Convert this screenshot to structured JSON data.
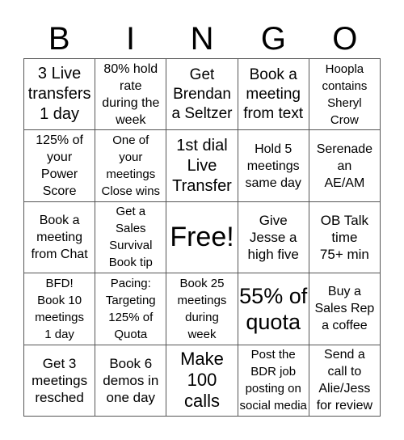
{
  "header": [
    "B",
    "I",
    "N",
    "G",
    "O"
  ],
  "cells": [
    [
      "3 Live\ntransfers\n1 day",
      "80% hold\nrate\nduring the\nweek",
      "Get\nBrendan\na Seltzer",
      "Book a\nmeeting\nfrom text",
      "Hoopla\ncontains\nSheryl\nCrow"
    ],
    [
      "125% of\nyour\nPower\nScore",
      "One of\nyour\nmeetings\nClose wins",
      "1st dial\nLive\nTransfer",
      "Hold 5\nmeetings\nsame day",
      "Serenade\nan\nAE/AM"
    ],
    [
      "Book a\nmeeting\nfrom Chat",
      "Get a\nSales\nSurvival\nBook tip",
      "Free!",
      "Give\nJesse a\nhigh five",
      "OB Talk\ntime\n75+ min"
    ],
    [
      "BFD!\nBook 10\nmeetings\n1 day",
      "Pacing:\nTargeting\n125% of\nQuota",
      "Book 25\nmeetings\nduring\nweek",
      "55% of\nquota",
      "Buy a\nSales Rep\na coffee"
    ],
    [
      "Get 3\nmeetings\nresched",
      "Book 6\ndemos in\none day",
      "Make\n100\ncalls",
      "Post the\nBDR job\nposting on\nsocial media",
      "Send a\ncall to\nAlie/Jess\nfor review"
    ]
  ]
}
